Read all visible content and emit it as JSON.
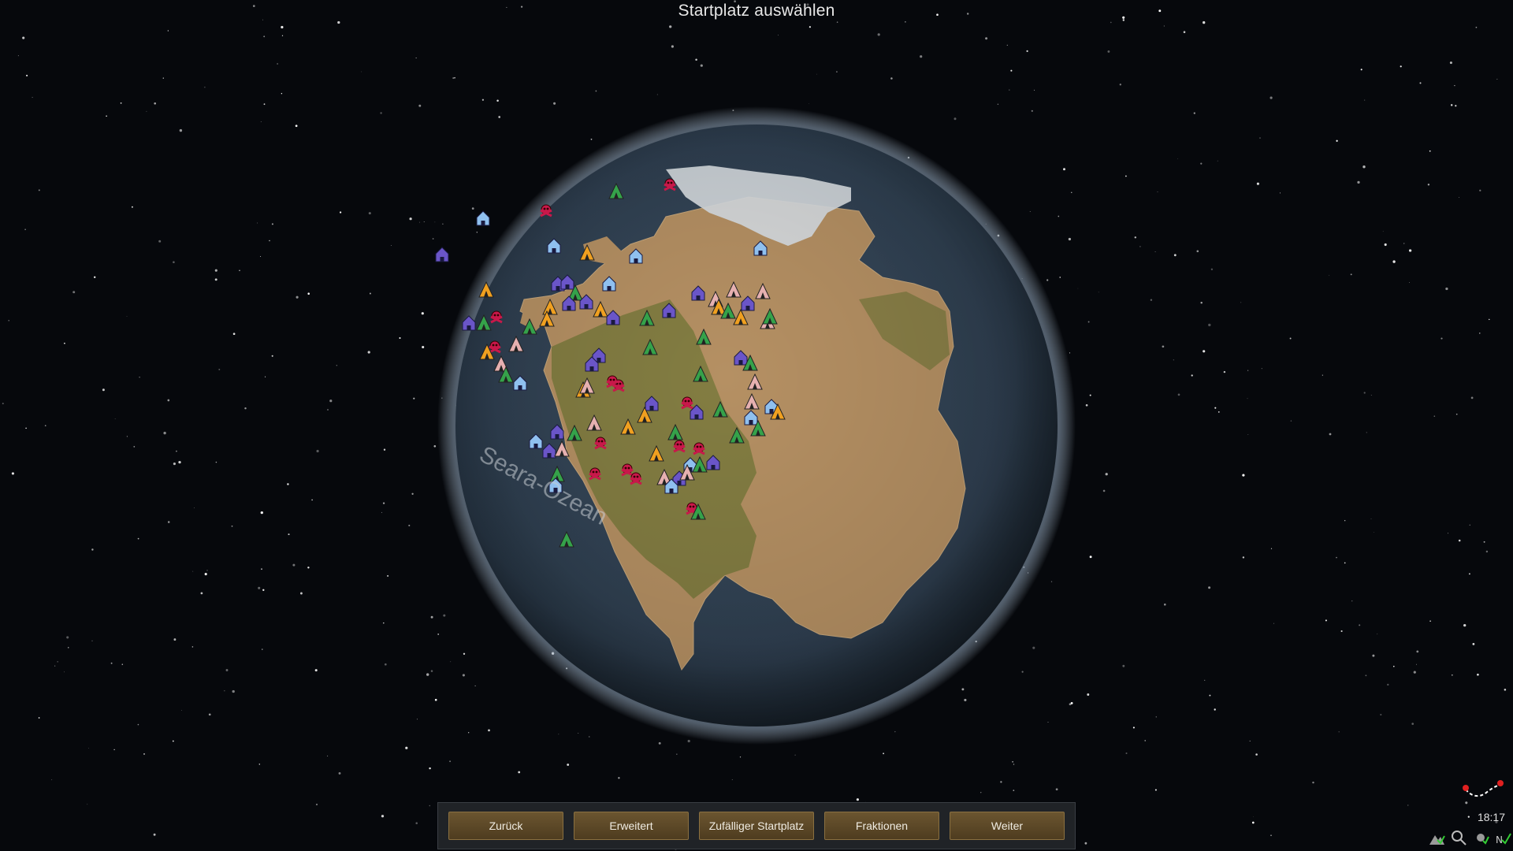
{
  "screen_title": "Startplatz auswählen",
  "ocean_label": "Seara-Ozean",
  "buttons": {
    "back": "Zurück",
    "advanced": "Erweitert",
    "random_site": "Zufälliger Startplatz",
    "factions": "Fraktionen",
    "next": "Weiter"
  },
  "clock": "18:17",
  "colors": {
    "settlement_blue": "#8fc0ef",
    "settlement_purple": "#6a55c8",
    "tribe_green": "#35a24a",
    "tribe_orange": "#f0a020",
    "tribe_pink": "#e6b0b0",
    "pirate_red": "#c8184a",
    "button_bg": "#5b4626"
  },
  "icons": {
    "pirate": "skull-crossbones-icon",
    "tribe": "tent-icon",
    "outlander": "house-icon",
    "empire": "tower-icon"
  }
}
